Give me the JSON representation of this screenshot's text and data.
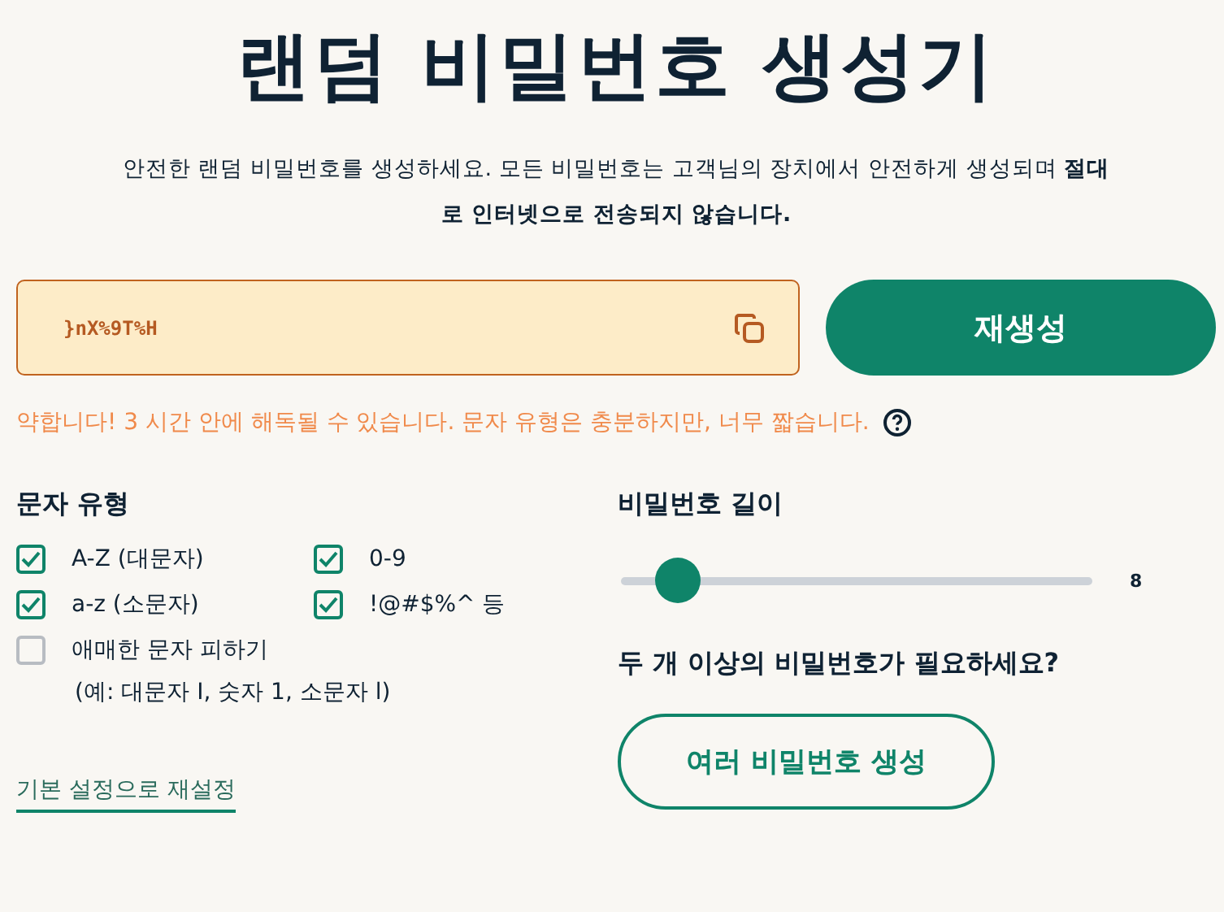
{
  "title": "랜덤 비밀번호 생성기",
  "description": "안전한 랜덤 비밀번호를 생성하세요. 모든 비밀번호는 고객님의 장치에서 안전하게 생성되며 **절대로 인터넷으로 전송되지 않습니다.**",
  "password": {
    "value": "}nX%9T%H"
  },
  "regenerate_button": "재생성",
  "strength": {
    "message": "약합니다! 3 시간 안에 해독될 수 있습니다. 문자 유형은 충분하지만, 너무 짧습니다."
  },
  "character_types": {
    "heading": "문자 유형",
    "options": [
      {
        "label": "A-Z (대문자)",
        "checked": true
      },
      {
        "label": "0-9",
        "checked": true
      },
      {
        "label": "a-z (소문자)",
        "checked": true
      },
      {
        "label": "!@#$%^ 등",
        "checked": true
      },
      {
        "label": "애매한 문자 피하기",
        "checked": false,
        "note": "(예: 대문자 I, 숫자 1, 소문자 l)"
      }
    ]
  },
  "reset_link": "기본 설정으로 재설정",
  "length": {
    "heading": "비밀번호 길이",
    "level": 0.08,
    "reading": "8"
  },
  "multiple": {
    "heading": "두 개 이상의 비밀번호가 필요하세요?",
    "button": "여러 비밀번호 생성"
  }
}
